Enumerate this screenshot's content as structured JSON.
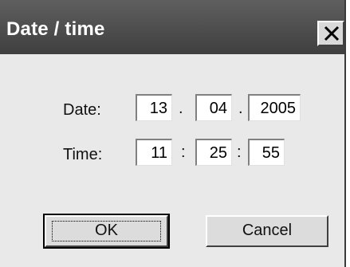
{
  "window": {
    "title": "Date / time"
  },
  "date": {
    "label": "Date:",
    "day": "13",
    "month": "04",
    "year": "2005",
    "separator": "."
  },
  "time": {
    "label": "Time:",
    "hour": "11",
    "minute": "25",
    "second": "55",
    "separator": ":"
  },
  "buttons": {
    "ok_label": "OK",
    "cancel_label": "Cancel"
  },
  "icons": {
    "close": "close-icon"
  }
}
